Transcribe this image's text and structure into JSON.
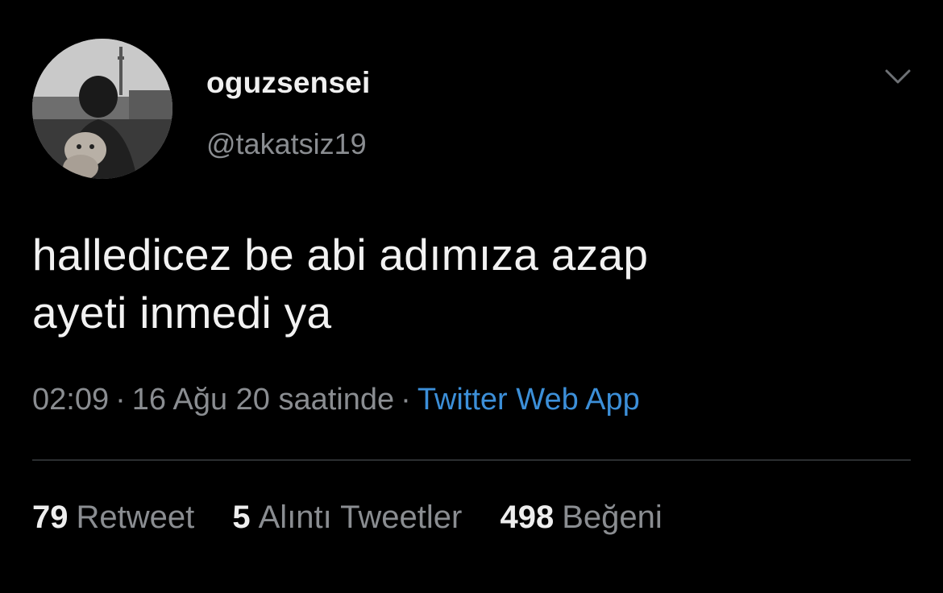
{
  "user": {
    "display_name": "oguzsensei",
    "handle": "@takatsiz19",
    "avatar_icon": "user-avatar-photo"
  },
  "tweet": {
    "text_line1": "halledicez be abi adımıza azap",
    "text_line2": "ayeti inmedi ya",
    "time": "02:09",
    "date": "16 Ağu 20 saatinde",
    "separator": "·",
    "source": "Twitter Web App"
  },
  "stats": {
    "retweets_count": "79",
    "retweets_label": "Retweet",
    "quotes_count": "5",
    "quotes_label": "Alıntı Tweetler",
    "likes_count": "498",
    "likes_label": "Beğeni"
  },
  "menu": {
    "icon": "chevron-down-icon"
  },
  "colors": {
    "background": "#000000",
    "text": "#f2f2f2",
    "muted": "#8a8d91",
    "link": "#3c8fd8",
    "divider": "#2b2e31"
  }
}
